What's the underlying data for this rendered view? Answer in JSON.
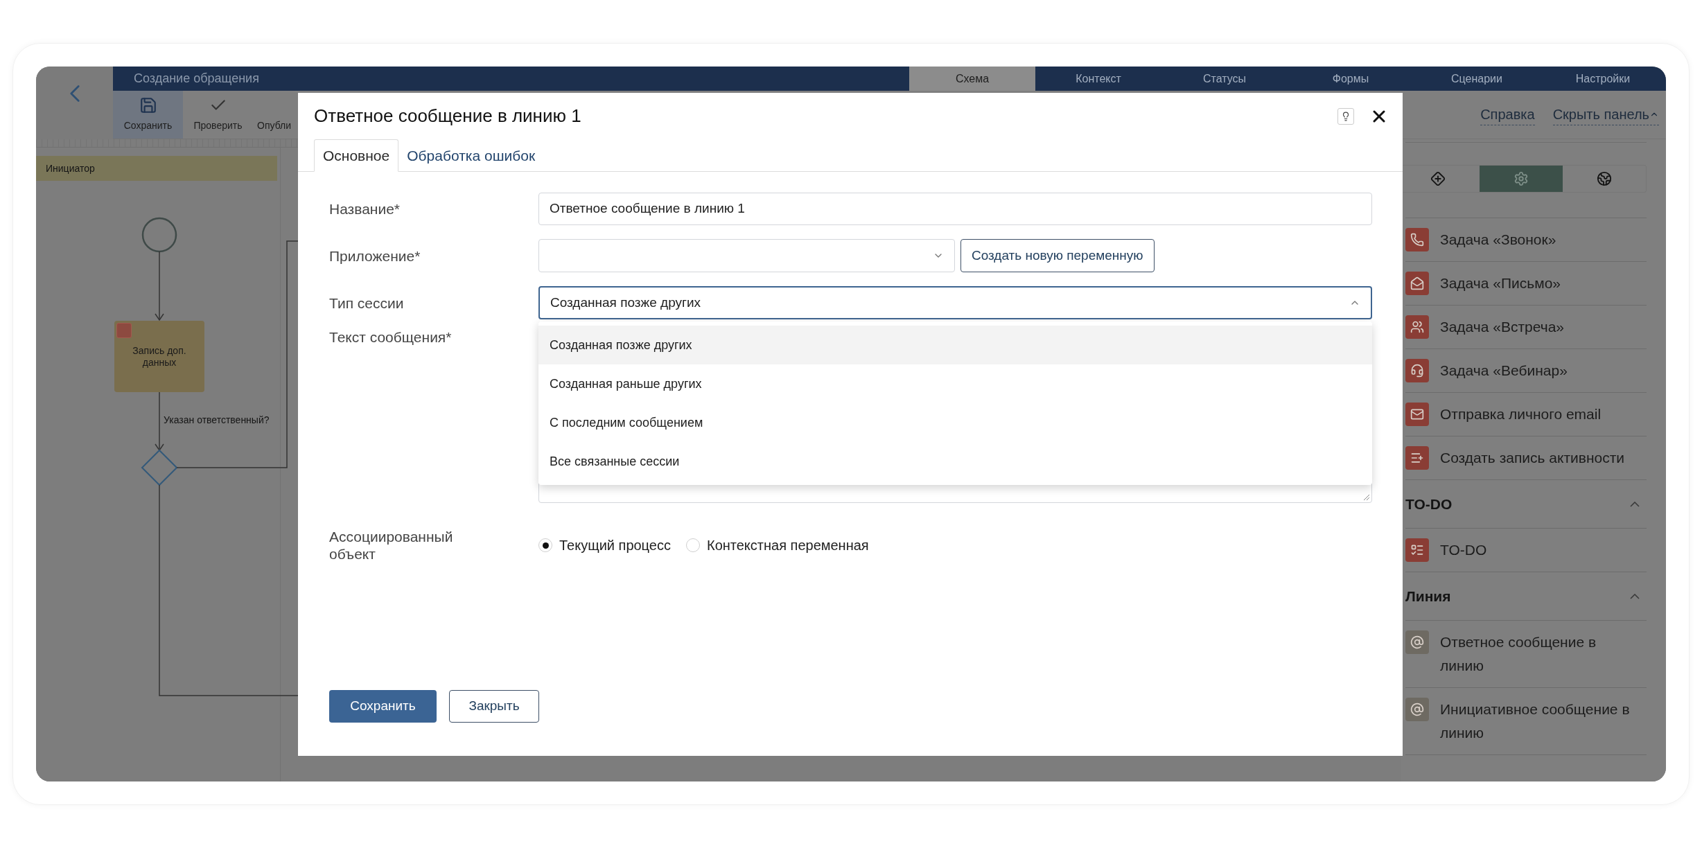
{
  "header": {
    "title": "Создание обращения",
    "tabs": [
      {
        "label": "Схема",
        "selected": true
      },
      {
        "label": "Контекст",
        "selected": false
      },
      {
        "label": "Статусы",
        "selected": false
      },
      {
        "label": "Формы",
        "selected": false
      },
      {
        "label": "Сценарии",
        "selected": false
      },
      {
        "label": "Настройки",
        "selected": false
      }
    ]
  },
  "toolbar": {
    "buttons": [
      {
        "kind": "save",
        "label": "Сохранить",
        "selected": true
      },
      {
        "kind": "check",
        "label": "Проверить",
        "selected": false
      },
      {
        "kind": "publish",
        "label": "Опубли",
        "selected": false
      }
    ],
    "links": [
      "Справка",
      "Скрыть панель"
    ]
  },
  "diagram": {
    "lane": "Инициатор",
    "task": "Запись доп. данных",
    "condition": "Указан ответственный?"
  },
  "side_panel": {
    "tabs": [
      {
        "kind": "shapes",
        "selected": false
      },
      {
        "kind": "settings",
        "selected": true
      },
      {
        "kind": "globe",
        "selected": false
      }
    ],
    "items": [
      {
        "kind": "call",
        "label": "Задача «Звонок»"
      },
      {
        "kind": "letter",
        "label": "Задача «Письмо»"
      },
      {
        "kind": "meeting",
        "label": "Задача «Встреча»"
      },
      {
        "kind": "webinar",
        "label": "Задача «Вебинар»"
      },
      {
        "kind": "email",
        "label": "Отправка личного email"
      },
      {
        "kind": "activity",
        "label": "Создать запись активности"
      }
    ],
    "groups": [
      {
        "title": "TO-DO",
        "expanded": true,
        "items": [
          {
            "kind": "todo",
            "label": "TO-DO"
          }
        ]
      },
      {
        "title": "Линия",
        "expanded": true,
        "items": [
          {
            "kind": "line",
            "label": "Ответное сообщение в линию"
          },
          {
            "kind": "line",
            "label": "Инициативное сообщение в линию"
          }
        ]
      }
    ]
  },
  "dialog": {
    "title": "Ответное сообщение в линию 1",
    "tabs": [
      {
        "label": "Основное",
        "selected": true
      },
      {
        "label": "Обработка ошибок",
        "selected": false
      }
    ],
    "fields": [
      {
        "kind": "text",
        "label": "Название*",
        "value": "Ответное сообщение в линию 1"
      },
      {
        "kind": "select",
        "label": "Приложение*",
        "expanded": false,
        "button": "Создать новую переменную"
      },
      {
        "kind": "select",
        "label": "Тип сессии",
        "value": "Созданная позже других",
        "expanded": true,
        "options": [
          {
            "label": "Созданная позже других",
            "selected": true
          },
          {
            "label": "Созданная раньше других",
            "selected": false
          },
          {
            "label": "С последним сообщением",
            "selected": false
          },
          {
            "label": "Все связанные сессии",
            "selected": false
          }
        ]
      },
      {
        "kind": "textarea",
        "label": "Текст сообщения*"
      },
      {
        "kind": "radio",
        "label": "Ассоциированный объект",
        "options": [
          {
            "label": "Текущий процесс",
            "selected": true
          },
          {
            "label": "Контекстная переменная",
            "selected": false
          }
        ]
      }
    ],
    "buttons": [
      {
        "kind": "primary",
        "label": "Сохранить"
      },
      {
        "kind": "secondary",
        "label": "Закрыть"
      }
    ]
  }
}
